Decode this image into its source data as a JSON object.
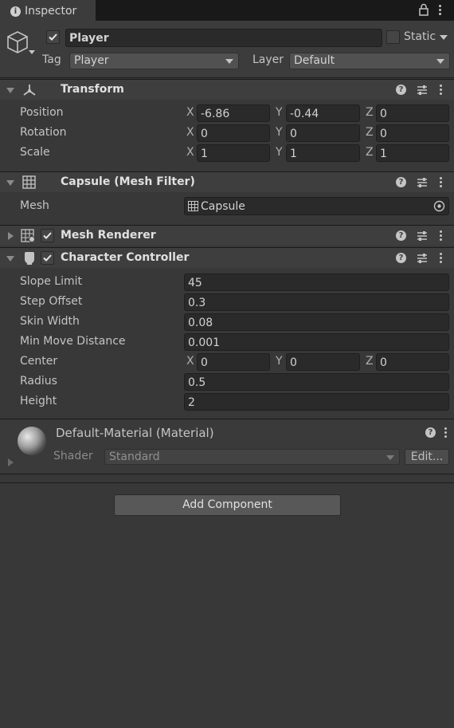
{
  "tab": {
    "title": "Inspector",
    "icon": "info-icon"
  },
  "gameobject": {
    "active": true,
    "name": "Player",
    "static_label": "Static",
    "static": false,
    "tag_label": "Tag",
    "tag_value": "Player",
    "layer_label": "Layer",
    "layer_value": "Default"
  },
  "transform": {
    "title": "Transform",
    "rows": [
      {
        "label": "Position",
        "x": "-6.86",
        "y": "-0.44",
        "z": "0"
      },
      {
        "label": "Rotation",
        "x": "0",
        "y": "0",
        "z": "0"
      },
      {
        "label": "Scale",
        "x": "1",
        "y": "1",
        "z": "1"
      }
    ],
    "axis": {
      "x": "X",
      "y": "Y",
      "z": "Z"
    }
  },
  "mesh_filter": {
    "title": "Capsule (Mesh Filter)",
    "mesh_label": "Mesh",
    "mesh_value": "Capsule"
  },
  "mesh_renderer": {
    "title": "Mesh Renderer",
    "enabled": true
  },
  "character_controller": {
    "title": "Character Controller",
    "enabled": true,
    "fields": [
      {
        "label": "Slope Limit",
        "value": "45"
      },
      {
        "label": "Step Offset",
        "value": "0.3"
      },
      {
        "label": "Skin Width",
        "value": "0.08"
      },
      {
        "label": "Min Move Distance",
        "value": "0.001"
      }
    ],
    "center_label": "Center",
    "center": {
      "x": "0",
      "y": "0",
      "z": "0"
    },
    "radius_label": "Radius",
    "radius": "0.5",
    "height_label": "Height",
    "height": "2"
  },
  "material": {
    "title": "Default-Material (Material)",
    "shader_label": "Shader",
    "shader_value": "Standard",
    "edit_label": "Edit..."
  },
  "add_component_label": "Add Component"
}
